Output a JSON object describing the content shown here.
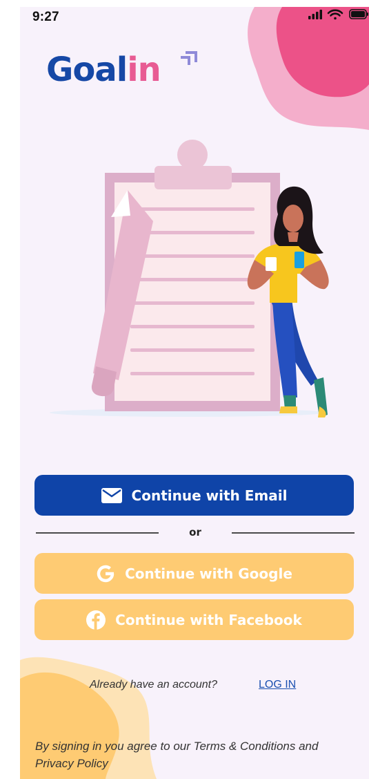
{
  "status_bar": {
    "time": "9:27",
    "icons": [
      "signal-icon",
      "wifi-icon",
      "battery-icon"
    ]
  },
  "brand": {
    "logo_part_1": "Goal",
    "logo_part_2": "in",
    "primary_color": "#1648a6",
    "accent_color": "#e85b93"
  },
  "actions": {
    "email_label": "Continue with Email",
    "divider_label": "or",
    "google_label": "Continue with Google",
    "facebook_label": "Continue with Facebook"
  },
  "account": {
    "prompt": "Already have an account?",
    "login_label": "LOG IN"
  },
  "legal": {
    "terms_text": "By signing in you agree to our Terms & Conditions and Privacy Policy"
  },
  "colors": {
    "email_button": "#0f44a8",
    "social_button": "#fecb73",
    "background": "#f8f2fb"
  }
}
